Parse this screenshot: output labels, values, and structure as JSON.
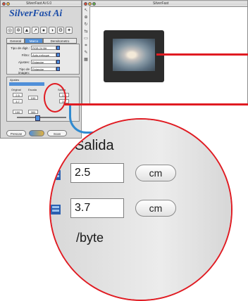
{
  "panel": {
    "title": "SilverFast Ai 6.0",
    "logo": "SilverFast Ai",
    "tabs": [
      "General",
      "Marco",
      "Densitometro"
    ],
    "settings": [
      {
        "label": "Tipo de digit.:",
        "value": "RGB 24 Bit"
      },
      {
        "label": "Filtro:",
        "value": "Auto-enfoque"
      },
      {
        "label": "Ajustes:",
        "value": "Estandar"
      },
      {
        "label": "Tipo de imagen:",
        "value": "Estandar"
      }
    ],
    "out_title": "Ajustes",
    "mini_left": [
      "2.5",
      "3.7"
    ],
    "mini_right": [
      "2.5",
      "3.7"
    ],
    "mini_col_labels": [
      "Original",
      "Escala",
      "Salida"
    ],
    "mini_bottom": [
      "100",
      "300"
    ],
    "bottom_buttons": [
      "Prescan",
      "Scan"
    ]
  },
  "preview": {
    "title": "SilverFast"
  },
  "zoom": {
    "heading": "Salida",
    "field1": "2.5",
    "unit1": "cm",
    "field2": "3.7",
    "unit2": "cm",
    "footer": "/byte"
  }
}
